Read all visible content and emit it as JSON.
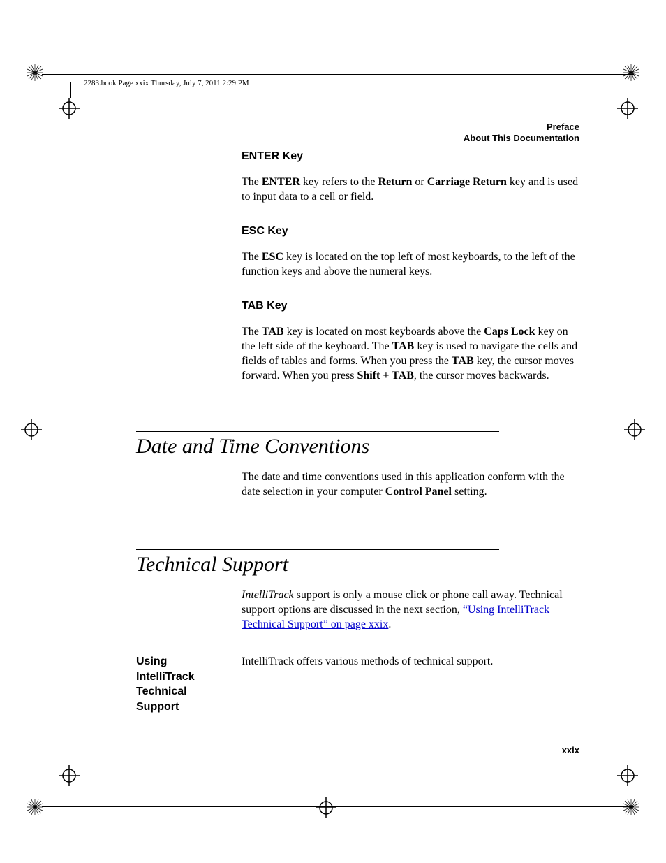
{
  "headerLine": "2283.book  Page xxix  Thursday, July 7, 2011  2:29 PM",
  "runningHead": {
    "line1": "Preface",
    "line2": "About This Documentation"
  },
  "sections": {
    "enter": {
      "heading": "ENTER Key",
      "p1a": "The ",
      "p1b": "ENTER",
      "p1c": " key refers to the ",
      "p1d": "Return",
      "p1e": " or ",
      "p1f": "Carriage Return",
      "p1g": " key and is used to input data to a cell or field."
    },
    "esc": {
      "heading": "ESC Key",
      "p1a": "The ",
      "p1b": "ESC",
      "p1c": " key is located on the top left of most keyboards, to the left of the function keys and above the numeral keys."
    },
    "tab": {
      "heading": "TAB Key",
      "p1a": "The ",
      "p1b": "TAB",
      "p1c": " key is located on most keyboards above the ",
      "p1d": "Caps Lock",
      "p1e": " key on the left side of the keyboard. The ",
      "p1f": "TAB",
      "p1g": " key is used to navigate the cells and fields of tables and forms. When you press the ",
      "p1h": "TAB",
      "p1i": " key, the cursor moves forward. When you press ",
      "p1j": "Shift + TAB",
      "p1k": ", the cursor moves backwards."
    },
    "datetime": {
      "heading": "Date and Time Conventions",
      "p1a": "The date and time conventions used in this application conform with the date selection in your computer ",
      "p1b": "Control Panel",
      "p1c": " setting."
    },
    "tech": {
      "heading": "Technical Support",
      "p1a": "IntelliTrack",
      "p1b": " support is only a mouse click or phone call away. Technical support options are discussed in the next section, ",
      "linkText": "“Using IntelliTrack Techni­cal Support” on page xxix",
      "p1c": "."
    },
    "using": {
      "sideHeading": "Using IntelliTrack Technical Support",
      "p1": "IntelliTrack offers various methods of technical support."
    }
  },
  "pageNum": "xxix"
}
